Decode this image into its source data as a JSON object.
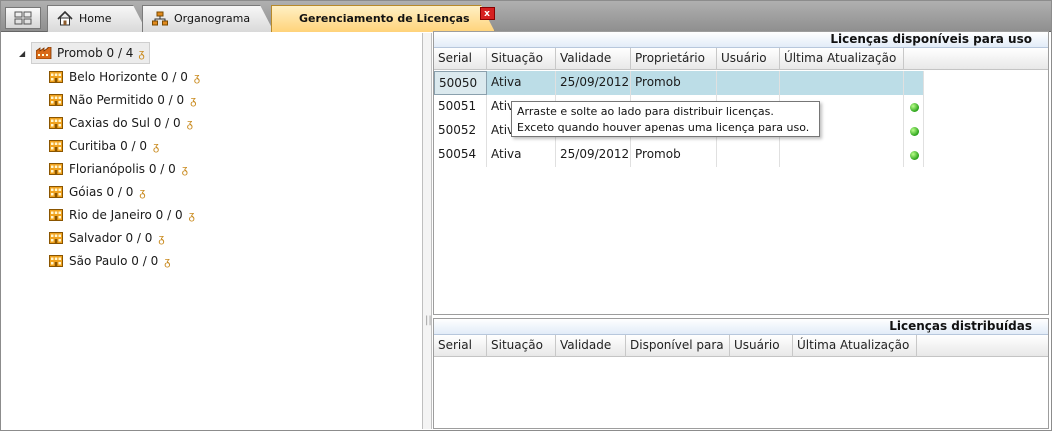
{
  "tabs": [
    {
      "label": "Home",
      "icon": "home-icon"
    },
    {
      "label": "Organograma",
      "icon": "org-chart-icon"
    },
    {
      "label": "Gerenciamento de Licenças",
      "icon": "close-icon",
      "close_label": "x"
    }
  ],
  "tree": {
    "root": {
      "label": "Promob 0 / 4"
    },
    "items": [
      {
        "label": "Belo Horizonte 0 / 0"
      },
      {
        "label": "Não Permitido 0 / 0"
      },
      {
        "label": "Caxias do Sul 0 / 0"
      },
      {
        "label": "Curitiba 0 / 0"
      },
      {
        "label": "Florianópolis 0 / 0"
      },
      {
        "label": "Góias 0 / 0"
      },
      {
        "label": "Rio de Janeiro 0 / 0"
      },
      {
        "label": "Salvador 0 / 0"
      },
      {
        "label": "São Paulo 0 / 0"
      }
    ]
  },
  "available": {
    "title": "Licenças disponíveis para uso",
    "columns": [
      "Serial",
      "Situação",
      "Validade",
      "Proprietário",
      "Usuário",
      "Última Atualização"
    ],
    "rows": [
      {
        "serial": "50050",
        "situacao": "Ativa",
        "validade": "25/09/2012",
        "proprietario": "Promob",
        "status": "none"
      },
      {
        "serial": "50051",
        "situacao": "Ativ",
        "validade": "",
        "proprietario": "",
        "status": "green"
      },
      {
        "serial": "50052",
        "situacao": "Ativ",
        "validade": "",
        "proprietario": "",
        "status": "green"
      },
      {
        "serial": "50054",
        "situacao": "Ativa",
        "validade": "25/09/2012",
        "proprietario": "Promob",
        "status": "green"
      }
    ],
    "tooltip": {
      "line1": "Arraste e solte ao lado para distribuir licenças.",
      "line2": "Exceto quando houver apenas uma licença para uso."
    }
  },
  "distributed": {
    "title": "Licenças distribuídas",
    "columns": [
      "Serial",
      "Situação",
      "Validade",
      "Disponível para",
      "Usuário",
      "Última Atualização"
    ]
  },
  "colors": {
    "active_tab": "#ffd37a",
    "selected_row": "#bcdde7",
    "status_ok": "#2aa21a",
    "close_button": "#d62020"
  }
}
